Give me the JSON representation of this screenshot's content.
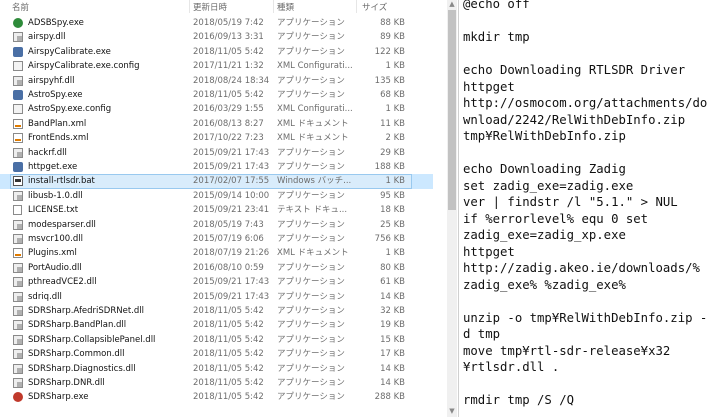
{
  "explorer": {
    "headers": {
      "name": "名前",
      "date": "更新日時",
      "type": "種類",
      "size": "サイズ"
    },
    "files": [
      {
        "name": "ADSBSpy.exe",
        "date": "2018/05/19 7:42",
        "type": "アプリケーション",
        "size": "88 KB",
        "icon": "exe-icon"
      },
      {
        "name": "airspy.dll",
        "date": "2016/09/13 3:31",
        "type": "アプリケーション",
        "size": "89 KB",
        "icon": "dll-icon"
      },
      {
        "name": "AirspyCalibrate.exe",
        "date": "2018/11/05 5:42",
        "type": "アプリケーション",
        "size": "122 KB",
        "icon": "exe-icon"
      },
      {
        "name": "AirspyCalibrate.exe.config",
        "date": "2017/11/21 1:32",
        "type": "XML Configurati...",
        "size": "1 KB",
        "icon": "config-icon"
      },
      {
        "name": "airspyhf.dll",
        "date": "2018/08/24 18:34",
        "type": "アプリケーション",
        "size": "135 KB",
        "icon": "dll-icon"
      },
      {
        "name": "AstroSpy.exe",
        "date": "2018/11/05 5:42",
        "type": "アプリケーション",
        "size": "68 KB",
        "icon": "exe-icon"
      },
      {
        "name": "AstroSpy.exe.config",
        "date": "2016/03/29 1:55",
        "type": "XML Configurati...",
        "size": "1 KB",
        "icon": "config-icon"
      },
      {
        "name": "BandPlan.xml",
        "date": "2016/08/13 8:27",
        "type": "XML ドキュメント",
        "size": "11 KB",
        "icon": "xml-icon"
      },
      {
        "name": "FrontEnds.xml",
        "date": "2017/10/22 7:23",
        "type": "XML ドキュメント",
        "size": "2 KB",
        "icon": "xml-icon"
      },
      {
        "name": "hackrf.dll",
        "date": "2015/09/21 17:43",
        "type": "アプリケーション",
        "size": "29 KB",
        "icon": "dll-icon"
      },
      {
        "name": "httpget.exe",
        "date": "2015/09/21 17:43",
        "type": "アプリケーション",
        "size": "188 KB",
        "icon": "exe-icon"
      },
      {
        "name": "install-rtlsdr.bat",
        "date": "2017/02/07 17:55",
        "type": "Windows バッチ...",
        "size": "1 KB",
        "icon": "batch-file-icon",
        "selected": true
      },
      {
        "name": "libusb-1.0.dll",
        "date": "2015/09/14 10:00",
        "type": "アプリケーション",
        "size": "95 KB",
        "icon": "dll-icon"
      },
      {
        "name": "LICENSE.txt",
        "date": "2015/09/21 23:41",
        "type": "テキスト ドキュ...",
        "size": "18 KB",
        "icon": "text-file-icon"
      },
      {
        "name": "modesparser.dll",
        "date": "2018/05/19 7:43",
        "type": "アプリケーション",
        "size": "25 KB",
        "icon": "dll-icon"
      },
      {
        "name": "msvcr100.dll",
        "date": "2015/07/19 6:06",
        "type": "アプリケーション",
        "size": "756 KB",
        "icon": "dll-icon"
      },
      {
        "name": "Plugins.xml",
        "date": "2018/07/19 21:26",
        "type": "XML ドキュメント",
        "size": "1 KB",
        "icon": "xml-icon"
      },
      {
        "name": "PortAudio.dll",
        "date": "2016/08/10 0:59",
        "type": "アプリケーション",
        "size": "80 KB",
        "icon": "dll-icon"
      },
      {
        "name": "pthreadVCE2.dll",
        "date": "2015/09/21 17:43",
        "type": "アプリケーション",
        "size": "61 KB",
        "icon": "dll-icon"
      },
      {
        "name": "sdriq.dll",
        "date": "2015/09/21 17:43",
        "type": "アプリケーション",
        "size": "14 KB",
        "icon": "dll-icon"
      },
      {
        "name": "SDRSharp.AfedriSDRNet.dll",
        "date": "2018/11/05 5:42",
        "type": "アプリケーション",
        "size": "32 KB",
        "icon": "dll-icon"
      },
      {
        "name": "SDRSharp.BandPlan.dll",
        "date": "2018/11/05 5:42",
        "type": "アプリケーション",
        "size": "19 KB",
        "icon": "dll-icon"
      },
      {
        "name": "SDRSharp.CollapsiblePanel.dll",
        "date": "2018/11/05 5:42",
        "type": "アプリケーション",
        "size": "15 KB",
        "icon": "dll-icon"
      },
      {
        "name": "SDRSharp.Common.dll",
        "date": "2018/11/05 5:42",
        "type": "アプリケーション",
        "size": "17 KB",
        "icon": "dll-icon"
      },
      {
        "name": "SDRSharp.Diagnostics.dll",
        "date": "2018/11/05 5:42",
        "type": "アプリケーション",
        "size": "14 KB",
        "icon": "dll-icon"
      },
      {
        "name": "SDRSharp.DNR.dll",
        "date": "2018/11/05 5:42",
        "type": "アプリケーション",
        "size": "14 KB",
        "icon": "dll-icon"
      },
      {
        "name": "SDRSharp.exe",
        "date": "2018/11/05 5:42",
        "type": "アプリケーション",
        "size": "288 KB",
        "icon": "exe-icon"
      }
    ]
  },
  "notepad": {
    "lines": [
      "@echo off",
      "",
      "mkdir tmp",
      "",
      "echo Downloading RTLSDR Driver",
      "httpget",
      "http://osmocom.org/attachments/do",
      "wnload/2242/RelWithDebInfo.zip",
      "tmp¥RelWithDebInfo.zip",
      "",
      "echo Downloading Zadig",
      "set zadig_exe=zadig.exe",
      "ver | findstr /l \"5.1.\" > NUL",
      "if %errorlevel% equ 0 set",
      "zadig_exe=zadig_xp.exe",
      "httpget",
      "http://zadig.akeo.ie/downloads/%",
      "zadig_exe% %zadig_exe%",
      "",
      "unzip -o tmp¥RelWithDebInfo.zip -",
      "d tmp",
      "move tmp¥rtl-sdr-release¥x32",
      "¥rtlsdr.dll .",
      "",
      "rmdir tmp /S /Q"
    ]
  }
}
